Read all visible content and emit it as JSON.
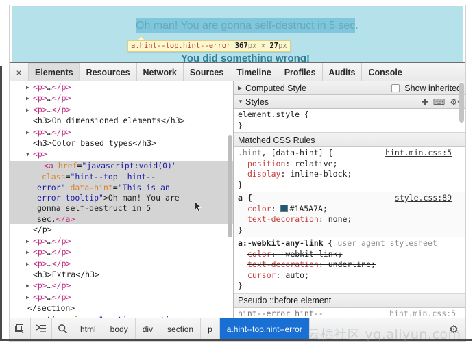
{
  "preview": {
    "background_color": "#b5e1ea",
    "hint_link_text": "Oh man! You are gonna self-destruct in 5 sec.",
    "hint_link_color": "#6aa8bb",
    "hint_link_highlight": "#7fc7dd",
    "below_text": "You did something wrong!",
    "below_text_color": "#2d7d94",
    "inspect_badge": {
      "selector": "a.hint--top.hint--error",
      "width": "367",
      "height": "27",
      "unit": "px",
      "separator": "×",
      "background": "#fdf7cd"
    }
  },
  "devtools": {
    "close_label": "×",
    "tabs": [
      {
        "label": "Elements",
        "active": true
      },
      {
        "label": "Resources",
        "active": false
      },
      {
        "label": "Network",
        "active": false
      },
      {
        "label": "Sources",
        "active": false
      },
      {
        "label": "Timeline",
        "active": false
      },
      {
        "label": "Profiles",
        "active": false
      },
      {
        "label": "Audits",
        "active": false
      },
      {
        "label": "Console",
        "active": false
      }
    ],
    "dom_tree": [
      {
        "indent": 3,
        "twisty": "collapsed",
        "parts": [
          {
            "c": "tag",
            "t": "<p>"
          },
          {
            "c": "txt",
            "t": "…"
          },
          {
            "c": "tag",
            "t": "</p>"
          }
        ]
      },
      {
        "indent": 3,
        "twisty": "collapsed",
        "parts": [
          {
            "c": "tag",
            "t": "<p>"
          },
          {
            "c": "txt",
            "t": "…"
          },
          {
            "c": "tag",
            "t": "</p>"
          }
        ]
      },
      {
        "indent": 3,
        "twisty": "collapsed",
        "parts": [
          {
            "c": "tag",
            "t": "<p>"
          },
          {
            "c": "txt",
            "t": "…"
          },
          {
            "c": "tag",
            "t": "</p>"
          }
        ]
      },
      {
        "indent": 3,
        "twisty": "none",
        "parts": [
          {
            "c": "punct",
            "t": "<h3>"
          },
          {
            "c": "txt",
            "t": "On dimensioned elements"
          },
          {
            "c": "punct",
            "t": "</h3>"
          }
        ]
      },
      {
        "indent": 3,
        "twisty": "collapsed",
        "parts": [
          {
            "c": "tag",
            "t": "<p>"
          },
          {
            "c": "txt",
            "t": "…"
          },
          {
            "c": "tag",
            "t": "</p>"
          }
        ]
      },
      {
        "indent": 3,
        "twisty": "none",
        "parts": [
          {
            "c": "punct",
            "t": "<h3>"
          },
          {
            "c": "txt",
            "t": "Color based types"
          },
          {
            "c": "punct",
            "t": "</h3>"
          }
        ]
      },
      {
        "indent": 3,
        "twisty": "expanded",
        "parts": [
          {
            "c": "tag",
            "t": "<p>"
          }
        ]
      },
      {
        "indent": 5,
        "twisty": "none",
        "selected": true,
        "parts": [
          {
            "c": "tag",
            "t": "<a "
          },
          {
            "c": "attr",
            "t": "href"
          },
          {
            "c": "punct",
            "t": "="
          },
          {
            "c": "val",
            "t": "\"javascript:void(0)\""
          },
          {
            "c": "txt",
            "t": "\n "
          },
          {
            "c": "attr",
            "t": "class"
          },
          {
            "c": "punct",
            "t": "="
          },
          {
            "c": "val",
            "t": "\"hint--top  hint--\nerror\""
          },
          {
            "c": "txt",
            "t": " "
          },
          {
            "c": "attr",
            "t": "data-hint"
          },
          {
            "c": "punct",
            "t": "="
          },
          {
            "c": "val",
            "t": "\"This is an\nerror tooltip\""
          },
          {
            "c": "punct",
            "t": ">"
          },
          {
            "c": "txt",
            "t": "Oh man! You are\ngonna self-destruct in 5\nsec."
          },
          {
            "c": "tag",
            "t": "</a>"
          }
        ]
      },
      {
        "indent": 3,
        "twisty": "none",
        "parts": [
          {
            "c": "punct",
            "t": "</p>"
          }
        ]
      },
      {
        "indent": 3,
        "twisty": "collapsed",
        "parts": [
          {
            "c": "tag",
            "t": "<p>"
          },
          {
            "c": "txt",
            "t": "…"
          },
          {
            "c": "tag",
            "t": "</p>"
          }
        ]
      },
      {
        "indent": 3,
        "twisty": "collapsed",
        "parts": [
          {
            "c": "tag",
            "t": "<p>"
          },
          {
            "c": "txt",
            "t": "…"
          },
          {
            "c": "tag",
            "t": "</p>"
          }
        ]
      },
      {
        "indent": 3,
        "twisty": "collapsed",
        "parts": [
          {
            "c": "tag",
            "t": "<p>"
          },
          {
            "c": "txt",
            "t": "…"
          },
          {
            "c": "tag",
            "t": "</p>"
          }
        ]
      },
      {
        "indent": 3,
        "twisty": "none",
        "parts": [
          {
            "c": "punct",
            "t": "<h3>"
          },
          {
            "c": "txt",
            "t": "Extra"
          },
          {
            "c": "punct",
            "t": "</h3>"
          }
        ]
      },
      {
        "indent": 3,
        "twisty": "collapsed",
        "parts": [
          {
            "c": "tag",
            "t": "<p>"
          },
          {
            "c": "txt",
            "t": "…"
          },
          {
            "c": "tag",
            "t": "</p>"
          }
        ]
      },
      {
        "indent": 3,
        "twisty": "collapsed",
        "parts": [
          {
            "c": "tag",
            "t": "<p>"
          },
          {
            "c": "txt",
            "t": "…"
          },
          {
            "c": "tag",
            "t": "</p>"
          }
        ]
      },
      {
        "indent": 2,
        "twisty": "none",
        "parts": [
          {
            "c": "punct",
            "t": "</section>"
          }
        ]
      },
      {
        "indent": 2,
        "twisty": "collapsed",
        "parts": [
          {
            "c": "punct",
            "t": "<section "
          },
          {
            "c": "attr",
            "t": "class"
          },
          {
            "c": "punct",
            "t": "="
          },
          {
            "c": "val",
            "t": "\"section  section--\nhow\""
          },
          {
            "c": "punct",
            "t": ">"
          },
          {
            "c": "txt",
            "t": "…"
          },
          {
            "c": "punct",
            "t": "</section>"
          }
        ]
      }
    ],
    "styles_panel": {
      "computed_style_label": "Computed Style",
      "show_inherited_label": "Show inherited",
      "show_inherited_checked": false,
      "styles_label": "Styles",
      "add_rule_icon": "plus-icon",
      "element_state_icon": "element-state-icon",
      "settings_icon": "gear-icon",
      "element_style": {
        "selector": "element.style {",
        "close": "}"
      },
      "matched_rules_label": "Matched CSS Rules",
      "rules": [
        {
          "selector_prefix": ".hint",
          "selector_rest": ", [data-hint] {",
          "origin": "hint.min.css:5",
          "declarations": [
            {
              "prop": "position",
              "value": "relative;"
            },
            {
              "prop": "display",
              "value": "inline-block;"
            }
          ],
          "close": "}"
        },
        {
          "selector_prefix": "a",
          "selector_rest": " {",
          "origin": "style.css:89",
          "declarations": [
            {
              "prop": "color",
              "value": "#1A5A7A;",
              "swatch": "#1A5A7A"
            },
            {
              "prop": "text-decoration",
              "value": "none;"
            }
          ],
          "close": "}"
        },
        {
          "selector_prefix": "a:-webkit-any-link",
          "selector_rest": " {",
          "origin_inline": "user agent stylesheet",
          "declarations": [
            {
              "prop": "color",
              "value": "-webkit-link;",
              "struck": true
            },
            {
              "prop": "text-decoration",
              "value": "underline;",
              "struck": true
            },
            {
              "prop": "cursor",
              "value": "auto;"
            }
          ],
          "close": "}"
        }
      ],
      "pseudo_label": "Pseudo ::before element",
      "pseudo_rule": {
        "selector": "hint--error hint--",
        "origin": "hint.min.css:5"
      }
    },
    "footer": {
      "inspect_icon": "inspect-element-icon",
      "dock_icon": "dock-to-side-icon",
      "search_icon": "search-icon",
      "settings_icon": "gear-icon",
      "breadcrumbs": [
        {
          "label": "html",
          "active": false
        },
        {
          "label": "body",
          "active": false
        },
        {
          "label": "div",
          "active": false
        },
        {
          "label": "section",
          "active": false
        },
        {
          "label": "p",
          "active": false
        },
        {
          "label": "a.hint--top.hint--error",
          "active": true
        }
      ],
      "active_color": "#1a6fd4"
    }
  },
  "watermark": {
    "text": "云栖社区 yq.aliyun.com"
  }
}
